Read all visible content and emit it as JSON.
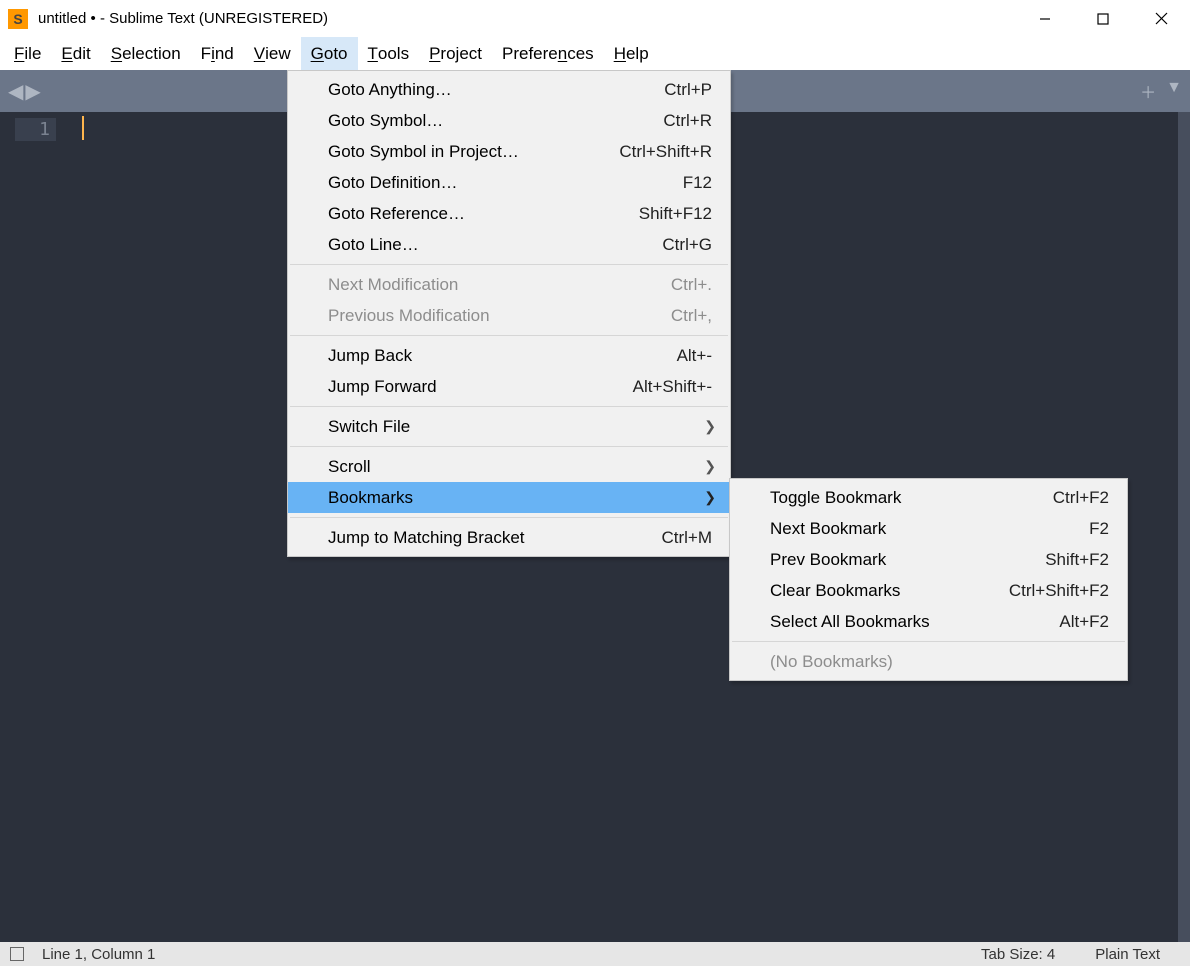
{
  "title": "untitled • - Sublime Text (UNREGISTERED)",
  "menubar": [
    {
      "label": "File",
      "u": "F"
    },
    {
      "label": "Edit",
      "u": "E"
    },
    {
      "label": "Selection",
      "u": "S"
    },
    {
      "label": "Find",
      "u": "i"
    },
    {
      "label": "View",
      "u": "V"
    },
    {
      "label": "Goto",
      "u": "G",
      "active": true
    },
    {
      "label": "Tools",
      "u": "T"
    },
    {
      "label": "Project",
      "u": "P"
    },
    {
      "label": "Preferences",
      "u": "n"
    },
    {
      "label": "Help",
      "u": "H"
    }
  ],
  "gutter": {
    "line": "1"
  },
  "goto_menu": [
    {
      "type": "item",
      "label": "Goto Anything…",
      "shortcut": "Ctrl+P"
    },
    {
      "type": "item",
      "label": "Goto Symbol…",
      "shortcut": "Ctrl+R"
    },
    {
      "type": "item",
      "label": "Goto Symbol in Project…",
      "shortcut": "Ctrl+Shift+R"
    },
    {
      "type": "item",
      "label": "Goto Definition…",
      "shortcut": "F12"
    },
    {
      "type": "item",
      "label": "Goto Reference…",
      "shortcut": "Shift+F12"
    },
    {
      "type": "item",
      "label": "Goto Line…",
      "shortcut": "Ctrl+G"
    },
    {
      "type": "sep"
    },
    {
      "type": "item",
      "label": "Next Modification",
      "shortcut": "Ctrl+.",
      "disabled": true
    },
    {
      "type": "item",
      "label": "Previous Modification",
      "shortcut": "Ctrl+,",
      "disabled": true
    },
    {
      "type": "sep"
    },
    {
      "type": "item",
      "label": "Jump Back",
      "shortcut": "Alt+-"
    },
    {
      "type": "item",
      "label": "Jump Forward",
      "shortcut": "Alt+Shift+-"
    },
    {
      "type": "sep"
    },
    {
      "type": "item",
      "label": "Switch File",
      "submenu": true
    },
    {
      "type": "sep"
    },
    {
      "type": "item",
      "label": "Scroll",
      "submenu": true
    },
    {
      "type": "item",
      "label": "Bookmarks",
      "submenu": true,
      "highlight": true
    },
    {
      "type": "sep"
    },
    {
      "type": "item",
      "label": "Jump to Matching Bracket",
      "shortcut": "Ctrl+M"
    }
  ],
  "bookmarks_menu": [
    {
      "type": "item",
      "label": "Toggle Bookmark",
      "shortcut": "Ctrl+F2"
    },
    {
      "type": "item",
      "label": "Next Bookmark",
      "shortcut": "F2"
    },
    {
      "type": "item",
      "label": "Prev Bookmark",
      "shortcut": "Shift+F2"
    },
    {
      "type": "item",
      "label": "Clear Bookmarks",
      "shortcut": "Ctrl+Shift+F2"
    },
    {
      "type": "item",
      "label": "Select All Bookmarks",
      "shortcut": "Alt+F2"
    },
    {
      "type": "sep"
    },
    {
      "type": "item",
      "label": "(No Bookmarks)",
      "disabled": true
    }
  ],
  "status": {
    "position": "Line 1, Column 1",
    "tabsize": "Tab Size: 4",
    "syntax": "Plain Text"
  }
}
